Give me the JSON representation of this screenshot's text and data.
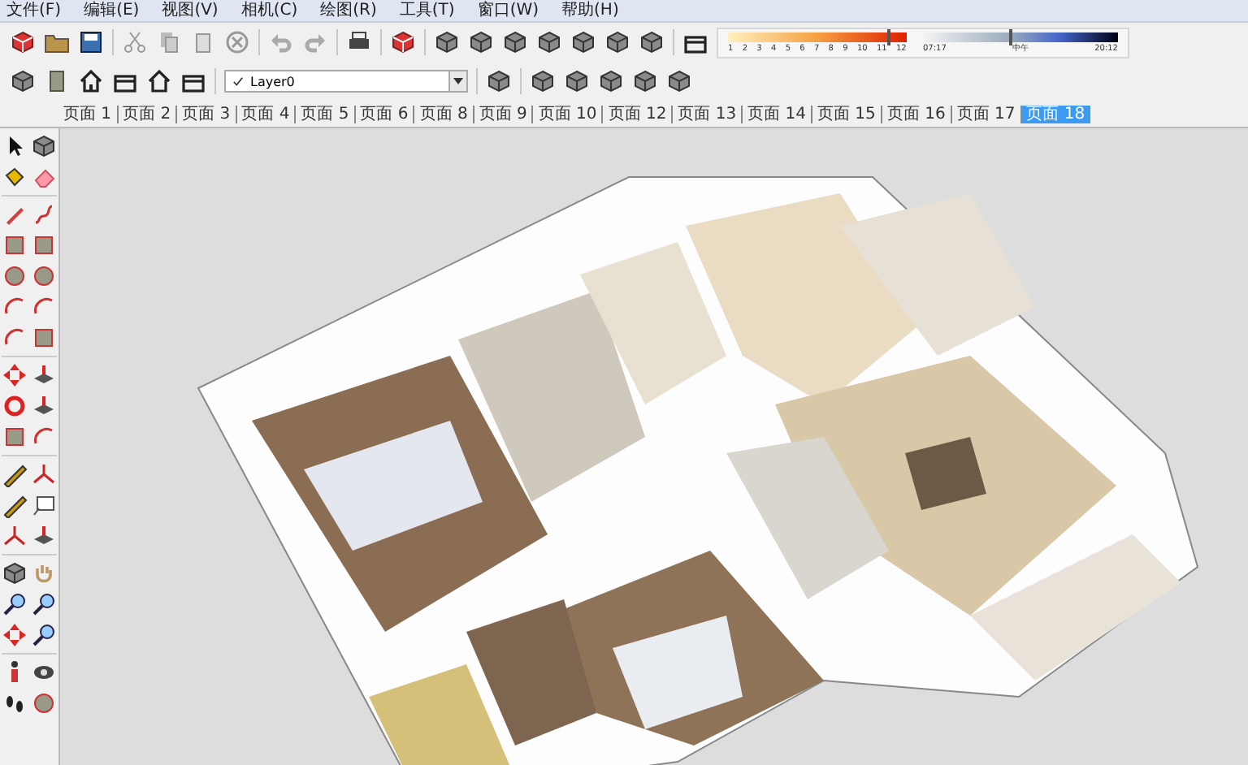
{
  "menu": [
    "文件(F)",
    "编辑(E)",
    "视图(V)",
    "相机(C)",
    "绘图(R)",
    "工具(T)",
    "窗口(W)",
    "帮助(H)"
  ],
  "layer_dropdown": {
    "value": "Layer0"
  },
  "shadow_settings": {
    "month_labels": [
      "1",
      "2",
      "3",
      "4",
      "5",
      "6",
      "7",
      "8",
      "9",
      "10",
      "11",
      "12"
    ],
    "month_slider": {
      "level": 0.9
    },
    "time_labels": [
      "07:17",
      "中午",
      "20:12"
    ],
    "time_slider": {
      "level": 0.45
    }
  },
  "scene_tabs": [
    {
      "label": "页面 1",
      "selected": false
    },
    {
      "label": "页面 2",
      "selected": false
    },
    {
      "label": "页面 3",
      "selected": false
    },
    {
      "label": "页面 4",
      "selected": false
    },
    {
      "label": "页面 5",
      "selected": false
    },
    {
      "label": "页面 6",
      "selected": false
    },
    {
      "label": "页面 8",
      "selected": false
    },
    {
      "label": "页面 9",
      "selected": false
    },
    {
      "label": "页面 10",
      "selected": false
    },
    {
      "label": "页面 12",
      "selected": false
    },
    {
      "label": "页面 13",
      "selected": false
    },
    {
      "label": "页面 14",
      "selected": false
    },
    {
      "label": "页面 15",
      "selected": false
    },
    {
      "label": "页面 16",
      "selected": false
    },
    {
      "label": "页面 17",
      "selected": false
    },
    {
      "label": "页面 18",
      "selected": true
    }
  ]
}
